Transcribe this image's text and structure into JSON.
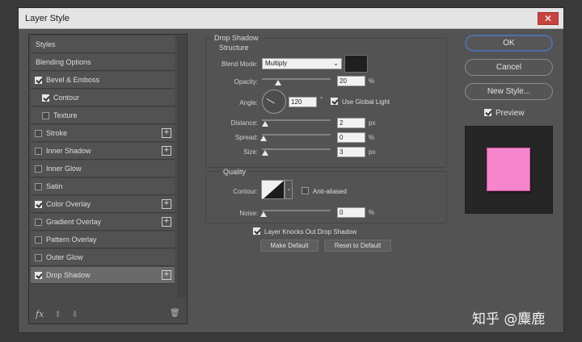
{
  "window": {
    "title": "Layer Style",
    "close_label": "✕"
  },
  "styles_list": {
    "items": [
      {
        "label": "Styles",
        "checkbox": false,
        "checked": false,
        "plus": false,
        "indent": false
      },
      {
        "label": "Blending Options",
        "checkbox": false,
        "checked": false,
        "plus": false,
        "indent": false
      },
      {
        "label": "Bevel & Emboss",
        "checkbox": true,
        "checked": true,
        "plus": false,
        "indent": false
      },
      {
        "label": "Contour",
        "checkbox": true,
        "checked": true,
        "plus": false,
        "indent": true
      },
      {
        "label": "Texture",
        "checkbox": true,
        "checked": false,
        "plus": false,
        "indent": true
      },
      {
        "label": "Stroke",
        "checkbox": true,
        "checked": false,
        "plus": true,
        "indent": false
      },
      {
        "label": "Inner Shadow",
        "checkbox": true,
        "checked": false,
        "plus": true,
        "indent": false
      },
      {
        "label": "Inner Glow",
        "checkbox": true,
        "checked": false,
        "plus": false,
        "indent": false
      },
      {
        "label": "Satin",
        "checkbox": true,
        "checked": false,
        "plus": false,
        "indent": false
      },
      {
        "label": "Color Overlay",
        "checkbox": true,
        "checked": true,
        "plus": true,
        "indent": false
      },
      {
        "label": "Gradient Overlay",
        "checkbox": true,
        "checked": false,
        "plus": true,
        "indent": false
      },
      {
        "label": "Pattern Overlay",
        "checkbox": true,
        "checked": false,
        "plus": false,
        "indent": false
      },
      {
        "label": "Outer Glow",
        "checkbox": true,
        "checked": false,
        "plus": false,
        "indent": false
      },
      {
        "label": "Drop Shadow",
        "checkbox": true,
        "checked": true,
        "plus": true,
        "indent": false,
        "selected": true
      }
    ],
    "footer": {
      "fx_label": "fx",
      "up_label": "⬆",
      "down_label": "⬇",
      "trash_label": "🗑"
    }
  },
  "drop_shadow": {
    "section_title": "Drop Shadow",
    "structure": {
      "title": "Structure",
      "blend_mode_label": "Blend Mode:",
      "blend_mode_value": "Multiply",
      "shadow_color": "#1f1f1f",
      "opacity_label": "Opacity:",
      "opacity_value": "20",
      "opacity_unit": "%",
      "angle_label": "Angle:",
      "angle_value": "120",
      "angle_unit": "°",
      "use_global_light_label": "Use Global Light",
      "use_global_light_checked": true,
      "distance_label": "Distance:",
      "distance_value": "2",
      "distance_unit": "px",
      "spread_label": "Spread:",
      "spread_value": "0",
      "spread_unit": "%",
      "size_label": "Size:",
      "size_value": "3",
      "size_unit": "px"
    },
    "quality": {
      "title": "Quality",
      "contour_label": "Contour:",
      "anti_aliased_label": "Anti-aliased",
      "anti_aliased_checked": false,
      "noise_label": "Noise:",
      "noise_value": "0",
      "noise_unit": "%"
    },
    "knocks_out_label": "Layer Knocks Out Drop Shadow",
    "knocks_out_checked": true,
    "make_default_label": "Make Default",
    "reset_default_label": "Reset to Default"
  },
  "actions": {
    "ok_label": "OK",
    "cancel_label": "Cancel",
    "new_style_label": "New Style...",
    "preview_label": "Preview",
    "preview_checked": true,
    "preview_color": "#f686cc"
  },
  "watermark": "知乎 @麋鹿"
}
